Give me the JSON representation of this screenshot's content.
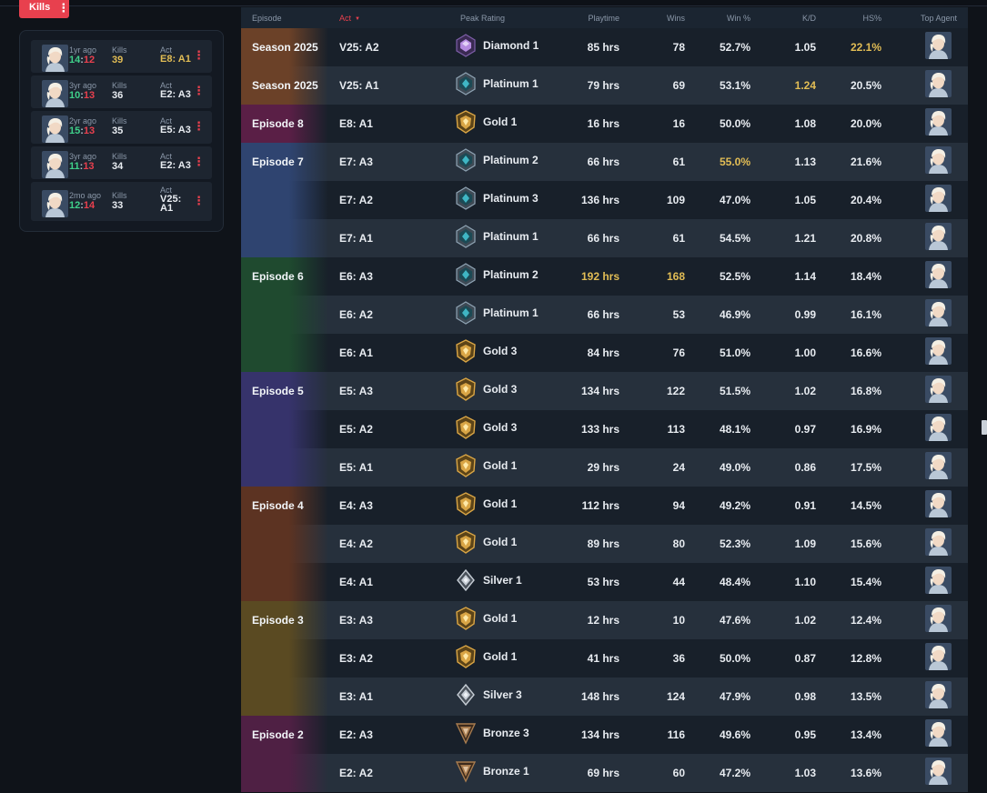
{
  "filter_button": {
    "label": "Kills",
    "menu": "⋮"
  },
  "recent_matches": [
    {
      "ago": "1yr ago",
      "wins": "14",
      "sep": ":",
      "losses": "12",
      "kills_label": "Kills",
      "kills": "39",
      "kills_highlight": true,
      "act_label": "Act",
      "act": "E8: A1",
      "act_highlight": true,
      "menu": "⋮"
    },
    {
      "ago": "3yr ago",
      "wins": "10",
      "sep": ":",
      "losses": "13",
      "kills_label": "Kills",
      "kills": "36",
      "kills_highlight": false,
      "act_label": "Act",
      "act": "E2: A3",
      "act_highlight": false,
      "menu": "⋮"
    },
    {
      "ago": "2yr ago",
      "wins": "15",
      "sep": ":",
      "losses": "13",
      "kills_label": "Kills",
      "kills": "35",
      "kills_highlight": false,
      "act_label": "Act",
      "act": "E5: A3",
      "act_highlight": false,
      "menu": "⋮"
    },
    {
      "ago": "3yr ago",
      "wins": "11",
      "sep": ":",
      "losses": "13",
      "kills_label": "Kills",
      "kills": "34",
      "kills_highlight": false,
      "act_label": "Act",
      "act": "E2: A3",
      "act_highlight": false,
      "menu": "⋮"
    },
    {
      "ago": "2mo ago",
      "wins": "12",
      "sep": ":",
      "losses": "14",
      "kills_label": "Kills",
      "kills": "33",
      "kills_highlight": false,
      "act_label": "Act",
      "act": "V25: A1",
      "act_highlight": false,
      "menu": "⋮"
    }
  ],
  "table": {
    "headers": {
      "episode": "Episode",
      "act": "Act",
      "peak_rating": "Peak Rating",
      "playtime": "Playtime",
      "wins": "Wins",
      "win_pct": "Win %",
      "kd": "K/D",
      "hs_pct": "HS%",
      "top_agent": "Top Agent"
    },
    "sort_column": "act",
    "rows": [
      {
        "episode": "Season 2025",
        "ep_color": "#6b4128",
        "act": "V25: A2",
        "rank": "Diamond 1",
        "tier": "diamond",
        "playtime": "85 hrs",
        "wins": "78",
        "win_pct": "52.7%",
        "kd": "1.05",
        "hs": "22.1%",
        "hl": [
          "hs"
        ]
      },
      {
        "episode": "Season 2025",
        "ep_color": "#6b4128",
        "act": "V25: A1",
        "rank": "Platinum 1",
        "tier": "platinum",
        "playtime": "79 hrs",
        "wins": "69",
        "win_pct": "53.1%",
        "kd": "1.24",
        "hs": "20.5%",
        "hl": [
          "kd"
        ]
      },
      {
        "episode": "Episode 8",
        "ep_color": "#5a1f46",
        "act": "E8: A1",
        "rank": "Gold 1",
        "tier": "gold",
        "playtime": "16 hrs",
        "wins": "16",
        "win_pct": "50.0%",
        "kd": "1.08",
        "hs": "20.0%",
        "hl": []
      },
      {
        "episode": "Episode 7",
        "ep_color": "#2f4470",
        "act": "E7: A3",
        "rank": "Platinum 2",
        "tier": "platinum",
        "playtime": "66 hrs",
        "wins": "61",
        "win_pct": "55.0%",
        "kd": "1.13",
        "hs": "21.6%",
        "hl": [
          "win_pct"
        ]
      },
      {
        "episode": "",
        "ep_color": "#2f4470",
        "act": "E7: A2",
        "rank": "Platinum 3",
        "tier": "platinum",
        "playtime": "136 hrs",
        "wins": "109",
        "win_pct": "47.0%",
        "kd": "1.05",
        "hs": "20.4%",
        "hl": []
      },
      {
        "episode": "",
        "ep_color": "#2f4470",
        "act": "E7: A1",
        "rank": "Platinum 1",
        "tier": "platinum",
        "playtime": "66 hrs",
        "wins": "61",
        "win_pct": "54.5%",
        "kd": "1.21",
        "hs": "20.8%",
        "hl": []
      },
      {
        "episode": "Episode 6",
        "ep_color": "#1f4a2f",
        "act": "E6: A3",
        "rank": "Platinum 2",
        "tier": "platinum",
        "playtime": "192 hrs",
        "wins": "168",
        "win_pct": "52.5%",
        "kd": "1.14",
        "hs": "18.4%",
        "hl": [
          "playtime",
          "wins"
        ]
      },
      {
        "episode": "",
        "ep_color": "#1f4a2f",
        "act": "E6: A2",
        "rank": "Platinum 1",
        "tier": "platinum",
        "playtime": "66 hrs",
        "wins": "53",
        "win_pct": "46.9%",
        "kd": "0.99",
        "hs": "16.1%",
        "hl": []
      },
      {
        "episode": "",
        "ep_color": "#1f4a2f",
        "act": "E6: A1",
        "rank": "Gold 3",
        "tier": "gold",
        "playtime": "84 hrs",
        "wins": "76",
        "win_pct": "51.0%",
        "kd": "1.00",
        "hs": "16.6%",
        "hl": []
      },
      {
        "episode": "Episode 5",
        "ep_color": "#36336b",
        "act": "E5: A3",
        "rank": "Gold 3",
        "tier": "gold",
        "playtime": "134 hrs",
        "wins": "122",
        "win_pct": "51.5%",
        "kd": "1.02",
        "hs": "16.8%",
        "hl": []
      },
      {
        "episode": "",
        "ep_color": "#36336b",
        "act": "E5: A2",
        "rank": "Gold 3",
        "tier": "gold",
        "playtime": "133 hrs",
        "wins": "113",
        "win_pct": "48.1%",
        "kd": "0.97",
        "hs": "16.9%",
        "hl": []
      },
      {
        "episode": "",
        "ep_color": "#36336b",
        "act": "E5: A1",
        "rank": "Gold 1",
        "tier": "gold",
        "playtime": "29 hrs",
        "wins": "24",
        "win_pct": "49.0%",
        "kd": "0.86",
        "hs": "17.5%",
        "hl": []
      },
      {
        "episode": "Episode 4",
        "ep_color": "#5c3322",
        "act": "E4: A3",
        "rank": "Gold 1",
        "tier": "gold",
        "playtime": "112 hrs",
        "wins": "94",
        "win_pct": "49.2%",
        "kd": "0.91",
        "hs": "14.5%",
        "hl": []
      },
      {
        "episode": "",
        "ep_color": "#5c3322",
        "act": "E4: A2",
        "rank": "Gold 1",
        "tier": "gold",
        "playtime": "89 hrs",
        "wins": "80",
        "win_pct": "52.3%",
        "kd": "1.09",
        "hs": "15.6%",
        "hl": []
      },
      {
        "episode": "",
        "ep_color": "#5c3322",
        "act": "E4: A1",
        "rank": "Silver 1",
        "tier": "silver",
        "playtime": "53 hrs",
        "wins": "44",
        "win_pct": "48.4%",
        "kd": "1.10",
        "hs": "15.4%",
        "hl": []
      },
      {
        "episode": "Episode 3",
        "ep_color": "#5a4a22",
        "act": "E3: A3",
        "rank": "Gold 1",
        "tier": "gold",
        "playtime": "12 hrs",
        "wins": "10",
        "win_pct": "47.6%",
        "kd": "1.02",
        "hs": "12.4%",
        "hl": []
      },
      {
        "episode": "",
        "ep_color": "#5a4a22",
        "act": "E3: A2",
        "rank": "Gold 1",
        "tier": "gold",
        "playtime": "41 hrs",
        "wins": "36",
        "win_pct": "50.0%",
        "kd": "0.87",
        "hs": "12.8%",
        "hl": []
      },
      {
        "episode": "",
        "ep_color": "#5a4a22",
        "act": "E3: A1",
        "rank": "Silver 3",
        "tier": "silver",
        "playtime": "148 hrs",
        "wins": "124",
        "win_pct": "47.9%",
        "kd": "0.98",
        "hs": "13.5%",
        "hl": []
      },
      {
        "episode": "Episode 2",
        "ep_color": "#4f2044",
        "act": "E2: A3",
        "rank": "Bronze 3",
        "tier": "bronze",
        "playtime": "134 hrs",
        "wins": "116",
        "win_pct": "49.6%",
        "kd": "0.95",
        "hs": "13.4%",
        "hl": []
      },
      {
        "episode": "",
        "ep_color": "#4f2044",
        "act": "E2: A2",
        "rank": "Bronze 1",
        "tier": "bronze",
        "playtime": "69 hrs",
        "wins": "60",
        "win_pct": "47.2%",
        "kd": "1.03",
        "hs": "13.6%",
        "hl": []
      }
    ]
  },
  "colors": {
    "accent_red": "#e8404e",
    "highlight_gold": "#e2bd55",
    "win_green": "#3fd08a",
    "tier_gold": "#d9a545",
    "tier_platinum": "#3fb6c4",
    "tier_diamond": "#b58be0",
    "tier_silver": "#c5ccd4",
    "tier_bronze": "#a87c4f"
  },
  "icons": {
    "rank": "rank-badge-icon",
    "agent": "agent-portrait-icon",
    "menu": "kebab-menu-icon",
    "sort": "sort-desc-icon"
  }
}
